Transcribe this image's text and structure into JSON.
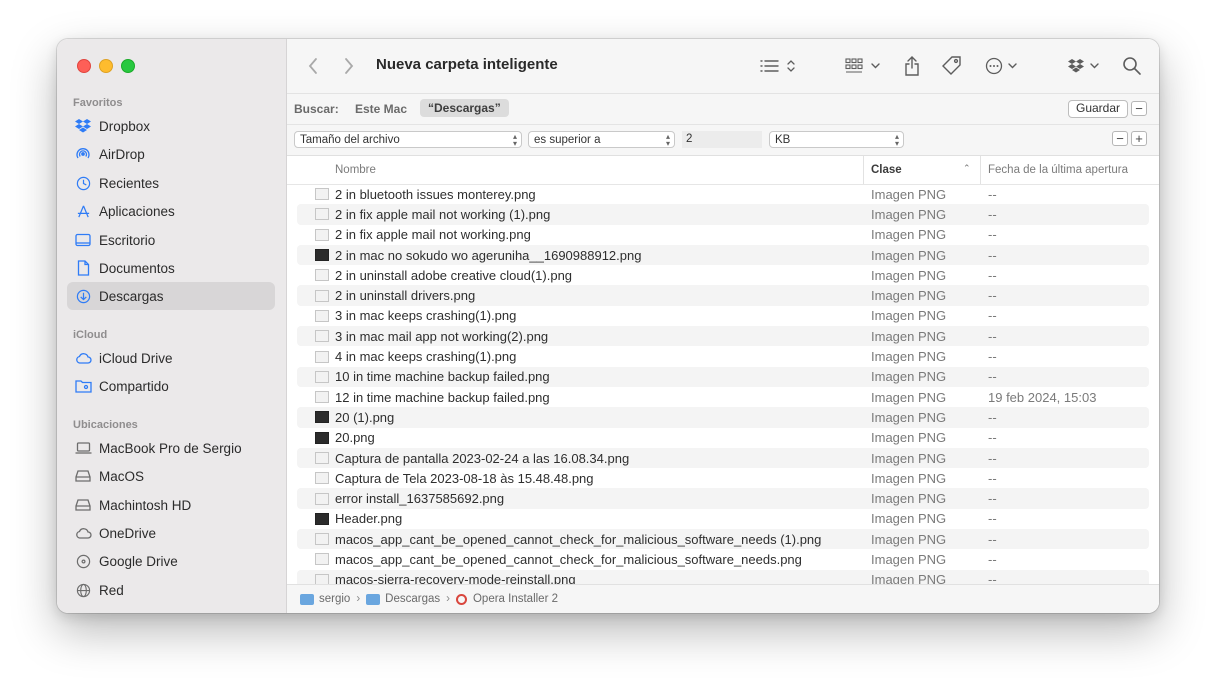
{
  "window": {
    "title": "Nueva carpeta inteligente"
  },
  "sidebar": {
    "sections": [
      {
        "label": "Favoritos",
        "items": [
          {
            "label": "Dropbox",
            "icon": "dropbox-icon"
          },
          {
            "label": "AirDrop",
            "icon": "airdrop-icon"
          },
          {
            "label": "Recientes",
            "icon": "clock-icon"
          },
          {
            "label": "Aplicaciones",
            "icon": "apps-icon"
          },
          {
            "label": "Escritorio",
            "icon": "desktop-icon"
          },
          {
            "label": "Documentos",
            "icon": "document-icon"
          },
          {
            "label": "Descargas",
            "icon": "download-icon",
            "active": true
          }
        ]
      },
      {
        "label": "iCloud",
        "items": [
          {
            "label": "iCloud Drive",
            "icon": "cloud-icon"
          },
          {
            "label": "Compartido",
            "icon": "shared-folder-icon"
          }
        ]
      },
      {
        "label": "Ubicaciones",
        "items": [
          {
            "label": "MacBook Pro de Sergio",
            "icon": "laptop-icon"
          },
          {
            "label": "MacOS",
            "icon": "disk-icon"
          },
          {
            "label": "Machintosh HD",
            "icon": "disk-icon"
          },
          {
            "label": "OneDrive",
            "icon": "cloud-icon"
          },
          {
            "label": "Google Drive",
            "icon": "drive-icon"
          },
          {
            "label": "Red",
            "icon": "globe-icon"
          }
        ]
      }
    ]
  },
  "search": {
    "label": "Buscar:",
    "scope_this_mac": "Este Mac",
    "scope_selected": "“Descargas”",
    "save_label": "Guardar",
    "remove_label": "−"
  },
  "criteria": {
    "attribute": "Tamaño del archivo",
    "operator": "es superior a",
    "value": "2",
    "unit": "KB",
    "remove_label": "−",
    "add_label": "+"
  },
  "columns": {
    "name": "Nombre",
    "kind": "Clase",
    "date": "Fecha de la última apertura"
  },
  "files": [
    {
      "name": "2 in bluetooth issues monterey.png",
      "kind": "Imagen PNG",
      "date": "--",
      "dark": false
    },
    {
      "name": "2 in fix apple mail not working (1).png",
      "kind": "Imagen PNG",
      "date": "--",
      "dark": false
    },
    {
      "name": "2 in fix apple mail not working.png",
      "kind": "Imagen PNG",
      "date": "--",
      "dark": false
    },
    {
      "name": "2 in mac no sokudo wo ageruniha__1690988912.png",
      "kind": "Imagen PNG",
      "date": "--",
      "dark": true
    },
    {
      "name": "2 in uninstall adobe creative cloud(1).png",
      "kind": "Imagen PNG",
      "date": "--",
      "dark": false
    },
    {
      "name": "2 in uninstall drivers.png",
      "kind": "Imagen PNG",
      "date": "--",
      "dark": false
    },
    {
      "name": "3 in mac keeps crashing(1).png",
      "kind": "Imagen PNG",
      "date": "--",
      "dark": false
    },
    {
      "name": "3 in mac mail app not working(2).png",
      "kind": "Imagen PNG",
      "date": "--",
      "dark": false
    },
    {
      "name": "4 in mac keeps crashing(1).png",
      "kind": "Imagen PNG",
      "date": "--",
      "dark": false
    },
    {
      "name": "10 in time machine backup failed.png",
      "kind": "Imagen PNG",
      "date": "--",
      "dark": false
    },
    {
      "name": "12 in time machine backup failed.png",
      "kind": "Imagen PNG",
      "date": "19 feb 2024, 15:03",
      "dark": false
    },
    {
      "name": "20 (1).png",
      "kind": "Imagen PNG",
      "date": "--",
      "dark": true
    },
    {
      "name": "20.png",
      "kind": "Imagen PNG",
      "date": "--",
      "dark": true
    },
    {
      "name": "Captura de pantalla 2023-02-24 a las 16.08.34.png",
      "kind": "Imagen PNG",
      "date": "--",
      "dark": false
    },
    {
      "name": "Captura de Tela 2023-08-18 às 15.48.48.png",
      "kind": "Imagen PNG",
      "date": "--",
      "dark": false
    },
    {
      "name": "error install_1637585692.png",
      "kind": "Imagen PNG",
      "date": "--",
      "dark": false
    },
    {
      "name": "Header.png",
      "kind": "Imagen PNG",
      "date": "--",
      "dark": true
    },
    {
      "name": "macos_app_cant_be_opened_cannot_check_for_malicious_software_needs (1).png",
      "kind": "Imagen PNG",
      "date": "--",
      "dark": false
    },
    {
      "name": "macos_app_cant_be_opened_cannot_check_for_malicious_software_needs.png",
      "kind": "Imagen PNG",
      "date": "--",
      "dark": false
    },
    {
      "name": "macos-sierra-recovery-mode-reinstall.png",
      "kind": "Imagen PNG",
      "date": "--",
      "dark": false
    }
  ],
  "pathbar": [
    {
      "label": "sergio",
      "icon": "home-folder-icon"
    },
    {
      "label": "Descargas",
      "icon": "downloads-folder-icon"
    },
    {
      "label": "Opera Installer 2",
      "icon": "opera-icon"
    }
  ],
  "colors": {
    "accent": "#2f7cf6",
    "sidebar_bg": "#ebe9ea",
    "selected_item": "#d8d6d7"
  }
}
